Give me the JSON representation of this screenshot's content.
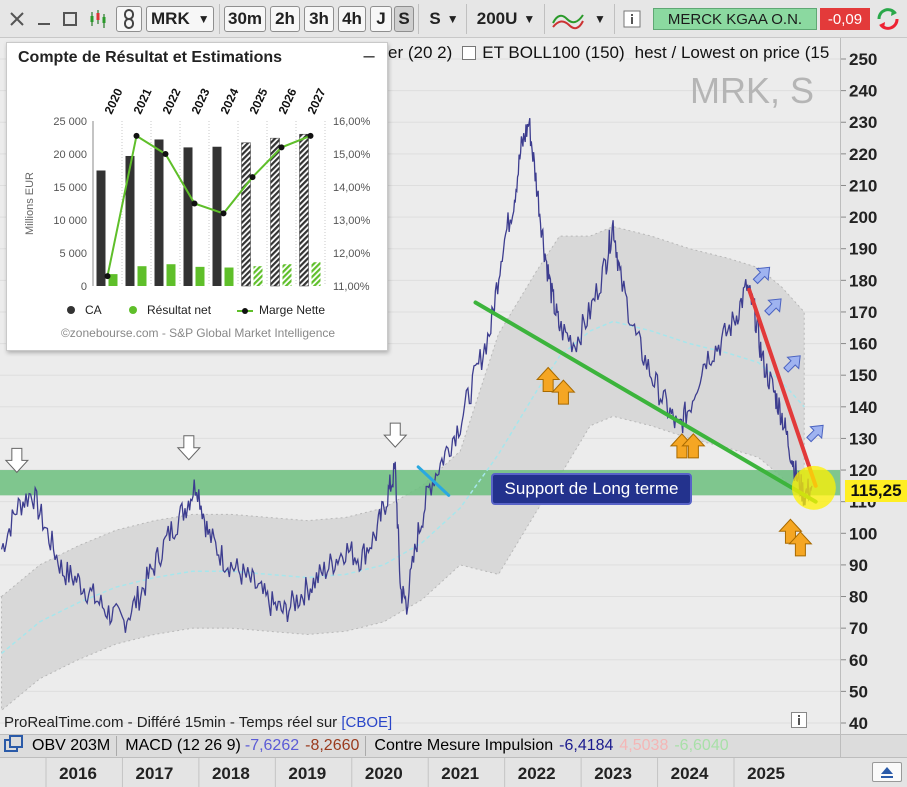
{
  "toolbar": {
    "ticker": "MRK",
    "timeframes": [
      "30m",
      "2h",
      "3h",
      "4h",
      "J",
      "S"
    ],
    "selected_timeframe": "S",
    "period_value": "S",
    "bars_value": "200U",
    "instrument_name": "MERCK KGAA O.N.",
    "change": "-0,09",
    "colors": {
      "instrument_bg": "#8bd9a0",
      "change_bg": "#e33a3a"
    }
  },
  "legend_top": {
    "fragment": "er (20 2)",
    "boll": "ET BOLL100 (150)",
    "highest": "hest / Lowest on price (15"
  },
  "watermark": "MRK, S",
  "credit": {
    "text": "ProRealTime.com - Différé 15min - Temps réel sur ",
    "link": "[CBOE]"
  },
  "annotations": {
    "support_label": "Support  de Long terme",
    "price_tag": "115,25"
  },
  "indicators": {
    "obv": "OBV 203M",
    "macd_label": "MACD (12 26 9)",
    "macd_v1": "-7,6262",
    "macd_v2": "-8,2660",
    "cm_label": "Contre Mesure  Impulsion",
    "cm_v1": "-6,4184",
    "cm_v2": "4,5038",
    "cm_v3": "-6,6040",
    "colors": {
      "macd_v1": "#5b5bd6",
      "macd_v2": "#9a3a1d",
      "cm_v1": "#1a1a8e",
      "cm_v2": "#f4b6b6",
      "cm_v3": "#a8e0a8"
    }
  },
  "inset": {
    "title": "Compte de Résultat et Estimations",
    "minimize": "–",
    "footer": "©zonebourse.com - S&P Global Market Intelligence",
    "legend": {
      "ca": "CA",
      "rn": "Résultat net",
      "mn": "Marge Nette"
    }
  },
  "chart_data": [
    {
      "type": "line",
      "x_axis_years": [
        "2016",
        "2017",
        "2018",
        "2019",
        "2020",
        "2021",
        "2022",
        "2023",
        "2024",
        "2025"
      ],
      "y_ticks": [
        40,
        50,
        60,
        70,
        80,
        90,
        100,
        110,
        120,
        130,
        140,
        150,
        160,
        170,
        180,
        190,
        200,
        210,
        220,
        230,
        240,
        250
      ],
      "y_tick_labels": [
        "40",
        "50",
        "60",
        "70",
        "80",
        "90",
        "100",
        "110",
        "120",
        "130",
        "140",
        "150",
        "160",
        "170",
        "180",
        "190",
        "200",
        "210",
        "220",
        "230",
        "240",
        "250"
      ],
      "ylim": [
        35,
        255
      ],
      "xlim": [
        2015.0,
        2025.9
      ],
      "series": [
        {
          "values": [
            [
              2015.0,
              95
            ],
            [
              2015.2,
              108
            ],
            [
              2015.4,
              113
            ],
            [
              2015.6,
              100
            ],
            [
              2015.8,
              88
            ],
            [
              2016.0,
              85
            ],
            [
              2016.2,
              80
            ],
            [
              2016.4,
              75
            ],
            [
              2016.6,
              72
            ],
            [
              2016.8,
              80
            ],
            [
              2017.0,
              90
            ],
            [
              2017.2,
              100
            ],
            [
              2017.4,
              108
            ],
            [
              2017.55,
              116
            ],
            [
              2017.7,
              100
            ],
            [
              2017.9,
              92
            ],
            [
              2018.1,
              88
            ],
            [
              2018.3,
              84
            ],
            [
              2018.5,
              78
            ],
            [
              2018.7,
              75
            ],
            [
              2018.9,
              80
            ],
            [
              2019.1,
              85
            ],
            [
              2019.3,
              90
            ],
            [
              2019.5,
              95
            ],
            [
              2019.7,
              92
            ],
            [
              2019.9,
              100
            ],
            [
              2020.05,
              112
            ],
            [
              2020.15,
              120
            ],
            [
              2020.22,
              82
            ],
            [
              2020.3,
              78
            ],
            [
              2020.45,
              100
            ],
            [
              2020.6,
              115
            ],
            [
              2020.8,
              125
            ],
            [
              2021.0,
              135
            ],
            [
              2021.2,
              150
            ],
            [
              2021.4,
              165
            ],
            [
              2021.55,
              190
            ],
            [
              2021.7,
              205
            ],
            [
              2021.8,
              222
            ],
            [
              2021.9,
              230
            ],
            [
              2022.0,
              210
            ],
            [
              2022.1,
              190
            ],
            [
              2022.2,
              175
            ],
            [
              2022.3,
              165
            ],
            [
              2022.5,
              160
            ],
            [
              2022.7,
              170
            ],
            [
              2022.9,
              185
            ],
            [
              2023.0,
              198
            ],
            [
              2023.1,
              180
            ],
            [
              2023.3,
              162
            ],
            [
              2023.5,
              150
            ],
            [
              2023.7,
              140
            ],
            [
              2023.85,
              133
            ],
            [
              2024.0,
              140
            ],
            [
              2024.2,
              155
            ],
            [
              2024.4,
              160
            ],
            [
              2024.6,
              168
            ],
            [
              2024.75,
              178
            ],
            [
              2024.85,
              170
            ],
            [
              2024.95,
              155
            ],
            [
              2025.1,
              145
            ],
            [
              2025.2,
              138
            ],
            [
              2025.3,
              128
            ],
            [
              2025.4,
              118
            ],
            [
              2025.5,
              112
            ],
            [
              2025.6,
              115
            ]
          ]
        },
        {
          "values": [
            [
              2015.0,
              62
            ],
            [
              2015.5,
              72
            ],
            [
              2016.0,
              78
            ],
            [
              2016.5,
              83
            ],
            [
              2017.0,
              86
            ],
            [
              2017.5,
              88
            ],
            [
              2018.0,
              88
            ],
            [
              2018.5,
              87
            ],
            [
              2019.0,
              86
            ],
            [
              2019.5,
              87
            ],
            [
              2020.0,
              90
            ],
            [
              2020.5,
              97
            ],
            [
              2021.0,
              108
            ],
            [
              2021.5,
              125
            ],
            [
              2022.0,
              145
            ],
            [
              2022.3,
              156
            ],
            [
              2022.7,
              164
            ],
            [
              2023.0,
              167
            ],
            [
              2023.5,
              164
            ],
            [
              2024.0,
              160
            ],
            [
              2024.5,
              157
            ],
            [
              2024.9,
              154
            ],
            [
              2025.2,
              148
            ],
            [
              2025.5,
              140
            ]
          ]
        }
      ],
      "lines": [
        {
          "from": [
            2021.2,
            173
          ],
          "to": [
            2025.65,
            110
          ]
        },
        {
          "from": [
            2024.78,
            177
          ],
          "to": [
            2025.65,
            115
          ]
        },
        {
          "from": [
            2020.45,
            121
          ],
          "to": [
            2020.85,
            112
          ]
        }
      ],
      "support_zone": [
        112,
        120
      ]
    },
    {
      "type": "bar",
      "categories": [
        "2020",
        "2021",
        "2022",
        "2023",
        "2024",
        "2025",
        "2026",
        "2027"
      ],
      "y_left_ticks": [
        "0",
        "5 000",
        "10 000",
        "15 000",
        "20 000",
        "25 000"
      ],
      "y_right_ticks": [
        "11,00%",
        "12,00%",
        "13,00%",
        "14,00%",
        "15,00%",
        "16,00%"
      ],
      "ylabel": "Millions EUR",
      "ylim": [
        0,
        25000
      ],
      "y2lim": [
        11,
        16
      ],
      "estimate_from": "2025",
      "series": [
        {
          "name": "CA",
          "values": [
            17500,
            19700,
            22200,
            21000,
            21100,
            21700,
            22400,
            23000
          ]
        },
        {
          "name": "Résultat net",
          "values": [
            1800,
            3000,
            3300,
            2900,
            2800,
            3000,
            3300,
            3600
          ]
        },
        {
          "name": "Marge Nette",
          "values": [
            11.3,
            15.55,
            15.0,
            13.5,
            13.2,
            14.3,
            15.2,
            15.55
          ]
        }
      ]
    }
  ]
}
